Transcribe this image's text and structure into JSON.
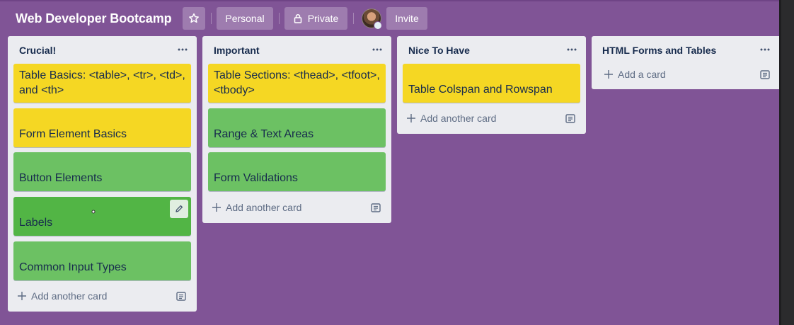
{
  "header": {
    "board_title": "Web Developer Bootcamp",
    "team_label": "Personal",
    "visibility_label": "Private",
    "invite_label": "Invite"
  },
  "lists": [
    {
      "title": "Crucial!",
      "cards": [
        {
          "label": "Table Basics: <table>, <tr>, <td>, and <th>",
          "color": "yellow"
        },
        {
          "label": "Form Element Basics",
          "color": "yellow"
        },
        {
          "label": "Button Elements",
          "color": "green"
        },
        {
          "label": "Labels",
          "color": "green"
        },
        {
          "label": "Common Input Types",
          "color": "green"
        }
      ],
      "add_label": "Add another card"
    },
    {
      "title": "Important",
      "cards": [
        {
          "label": "Table Sections: <thead>, <tfoot>, <tbody>",
          "color": "yellow"
        },
        {
          "label": "Range & Text Areas",
          "color": "green"
        },
        {
          "label": "Form Validations",
          "color": "green"
        }
      ],
      "add_label": "Add another card"
    },
    {
      "title": "Nice To Have",
      "cards": [
        {
          "label": "Table Colspan and Rowspan",
          "color": "yellow"
        }
      ],
      "add_label": "Add another card"
    },
    {
      "title": "HTML Forms and Tables",
      "cards": [],
      "add_label": "Add a card"
    }
  ],
  "colors": {
    "board_background": "#805496",
    "list_background": "#ebecf0",
    "card_yellow": "#f5d723",
    "card_green": "#6cc163"
  },
  "icons": [
    "star-icon",
    "lock-icon",
    "list-menu-icon",
    "plus-icon",
    "card-template-icon",
    "pencil-icon"
  ]
}
